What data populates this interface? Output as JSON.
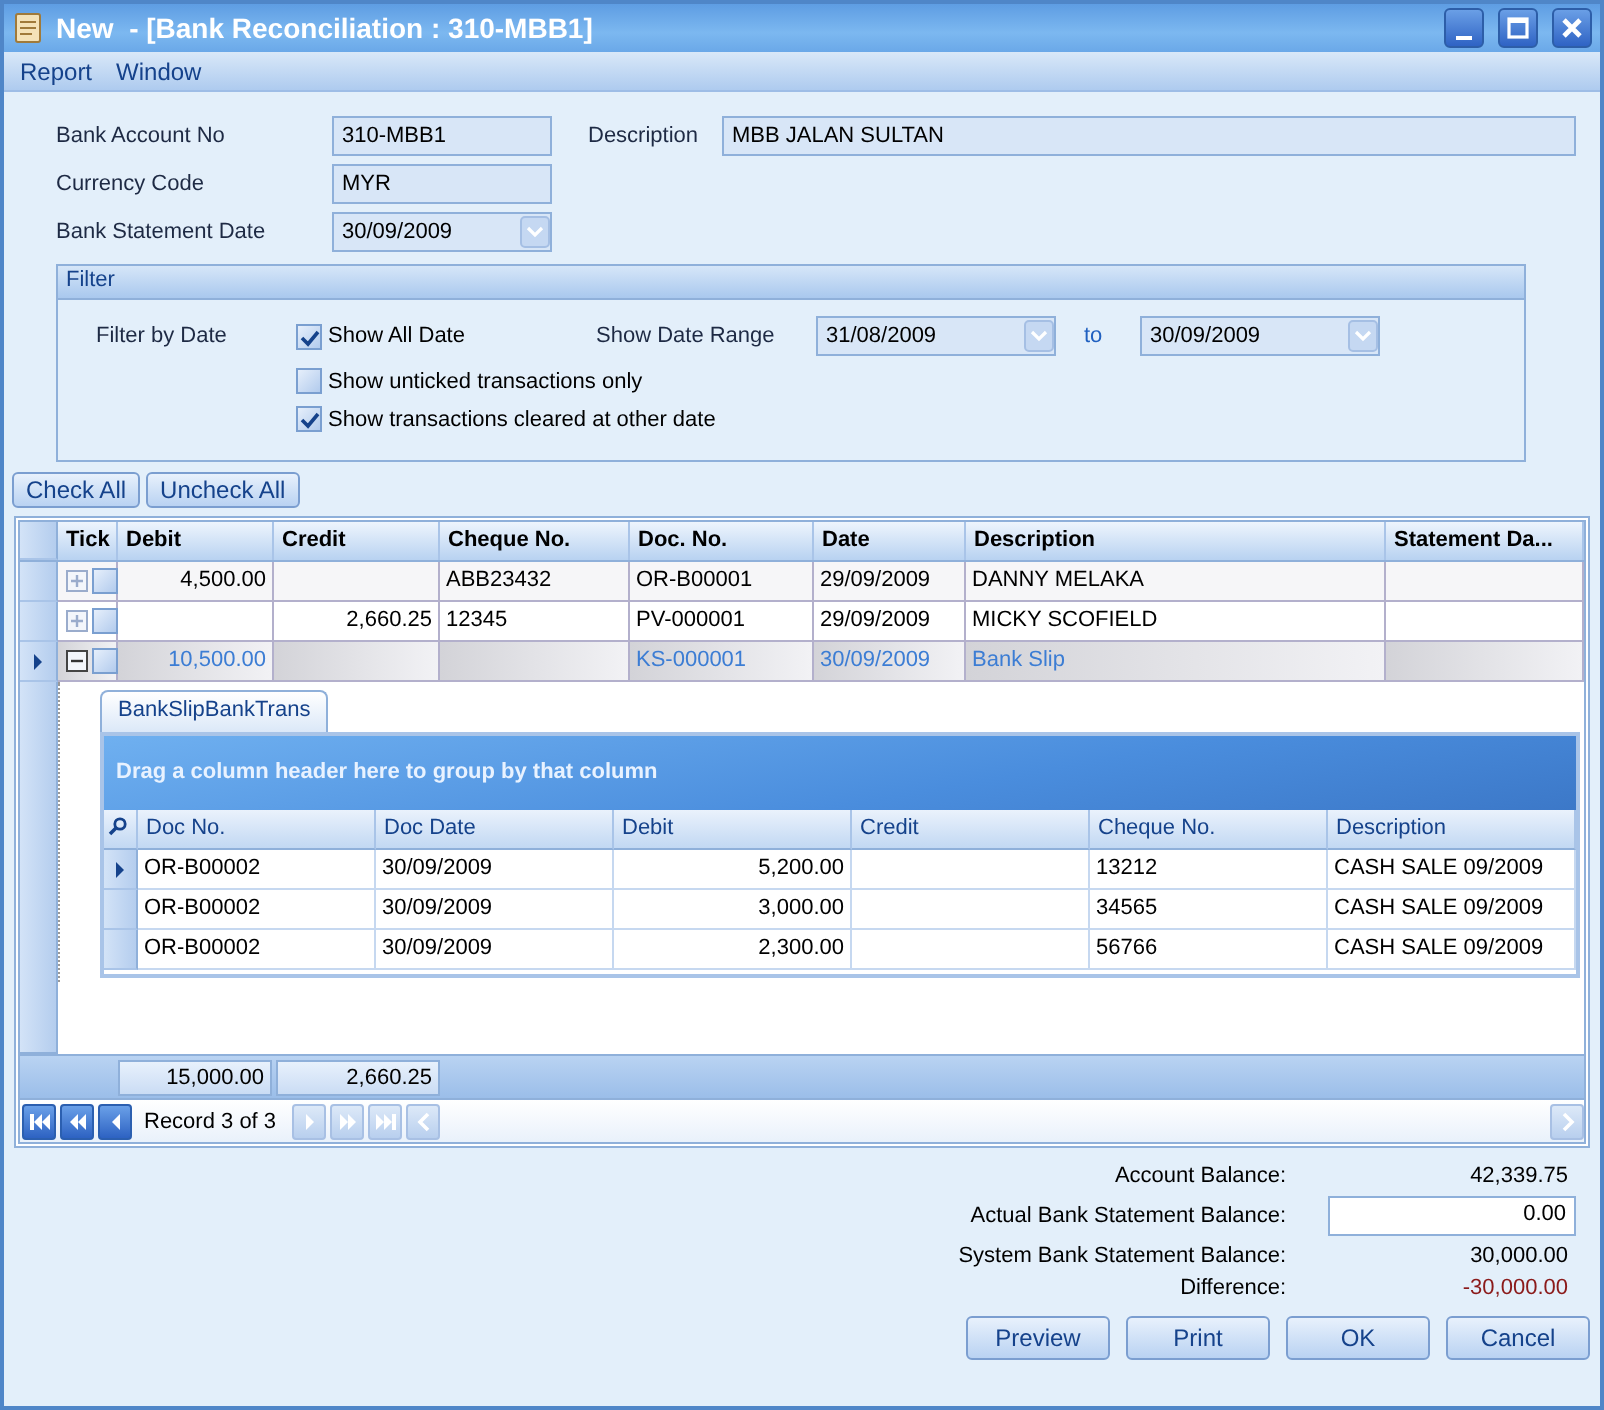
{
  "window": {
    "title": "New  - [Bank Reconciliation : 310-MBB1]"
  },
  "menu": [
    "Report",
    "Window"
  ],
  "header_fields": [
    {
      "label": "Bank Account No",
      "value": "310-MBB1",
      "kind": "text"
    },
    {
      "label": "Currency Code",
      "value": "MYR",
      "kind": "text"
    },
    {
      "label": "Bank Statement Date",
      "value": "30/09/2009",
      "kind": "date"
    }
  ],
  "description": {
    "label": "Description",
    "value": "MBB JALAN SULTAN"
  },
  "filter": {
    "title": "Filter",
    "by_label": "Filter by Date",
    "range_label": "Show Date Range",
    "from": "31/08/2009",
    "to_label": "to",
    "to": "30/09/2009",
    "options": [
      {
        "label": "Show All Date",
        "checked": true
      },
      {
        "label": "Show unticked transactions only",
        "checked": false
      },
      {
        "label": "Show transactions cleared at other date",
        "checked": true
      }
    ]
  },
  "actions": [
    "Check All",
    "Uncheck All"
  ],
  "grid": {
    "columns": [
      "Tick",
      "Debit",
      "Credit",
      "Cheque No.",
      "Doc. No.",
      "Date",
      "Description",
      "Statement Da..."
    ],
    "rows": [
      {
        "selected": false,
        "expanded": false,
        "ticked": false,
        "cells": {
          "debit": "4,500.00",
          "cheque_no": "ABB23432",
          "doc_no": "OR-B00001",
          "date": "29/09/2009",
          "description": "DANNY MELAKA"
        }
      },
      {
        "selected": false,
        "expanded": false,
        "ticked": false,
        "cells": {
          "credit": "2,660.25",
          "cheque_no": "12345",
          "doc_no": "PV-000001",
          "date": "29/09/2009",
          "description": "MICKY SCOFIELD"
        }
      },
      {
        "selected": true,
        "expanded": true,
        "ticked": false,
        "cells": {
          "debit": "10,500.00",
          "doc_no": "KS-000001",
          "date": "30/09/2009",
          "description": "Bank Slip"
        }
      }
    ],
    "detail": {
      "tab": "BankSlipBankTrans",
      "group_hint": "Drag a column header here to group by that column",
      "columns": [
        "Doc No.",
        "Doc Date",
        "Debit",
        "Credit",
        "Cheque No.",
        "Description"
      ],
      "rows": [
        {
          "selected": true,
          "cells": {
            "doc_no": "OR-B00002",
            "doc_date": "30/09/2009",
            "debit": "5,200.00",
            "cheque_no": "13212",
            "description": "CASH SALE 09/2009"
          }
        },
        {
          "selected": false,
          "cells": {
            "doc_no": "OR-B00002",
            "doc_date": "30/09/2009",
            "debit": "3,000.00",
            "cheque_no": "34565",
            "description": "CASH SALE 09/2009"
          }
        },
        {
          "selected": false,
          "cells": {
            "doc_no": "OR-B00002",
            "doc_date": "30/09/2009",
            "debit": "2,300.00",
            "cheque_no": "56766",
            "description": "CASH SALE 09/2009"
          }
        }
      ]
    },
    "totals": {
      "debit": "15,000.00",
      "credit": "2,660.25"
    },
    "navigator": {
      "record": "Record 3 of 3",
      "buttons": [
        {
          "kind": "first",
          "disabled": false
        },
        {
          "kind": "prev_page",
          "disabled": false
        },
        {
          "kind": "prev",
          "disabled": false
        },
        {
          "kind": "next",
          "disabled": true
        },
        {
          "kind": "next_page",
          "disabled": true
        },
        {
          "kind": "last",
          "disabled": true
        }
      ]
    }
  },
  "summary": [
    {
      "label": "Account Balance",
      "value": "42,339.75",
      "kind": "value"
    },
    {
      "label": "Actual Bank Statement Balance",
      "value": "0.00",
      "kind": "input"
    },
    {
      "label": "System Bank Statement Balance",
      "value": "30,000.00",
      "kind": "value"
    },
    {
      "label": "Difference",
      "value": "-30,000.00",
      "kind": "negative"
    }
  ],
  "summary_separator": ":",
  "buttons": [
    "Preview",
    "Print",
    "OK",
    "Cancel"
  ]
}
